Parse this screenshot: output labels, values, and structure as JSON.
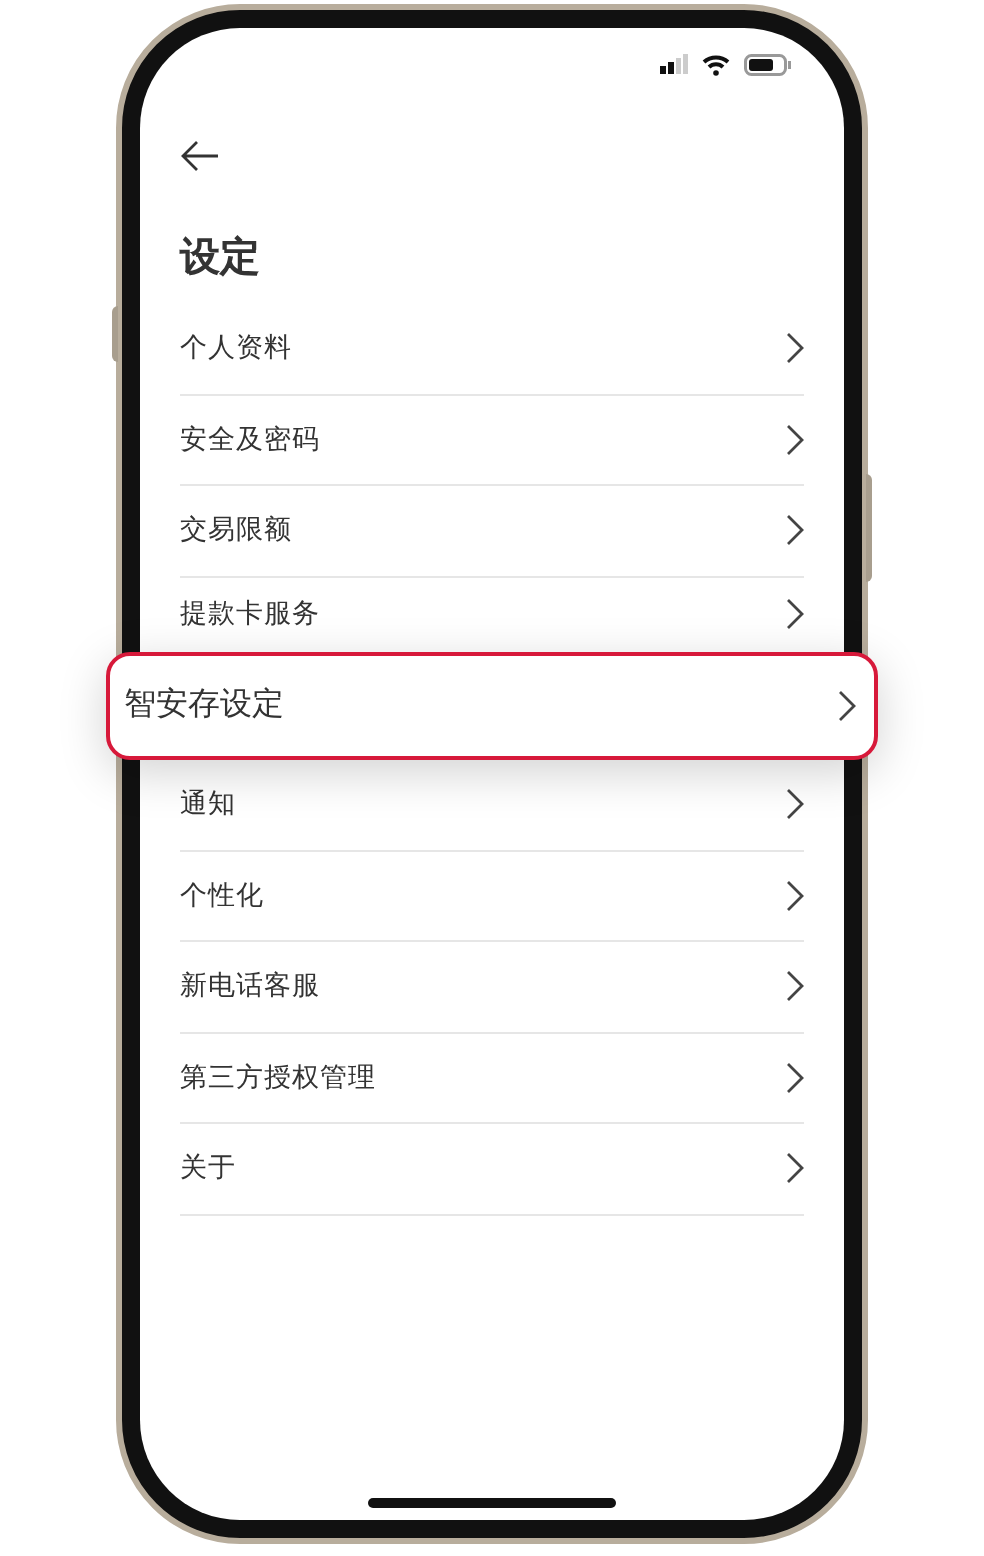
{
  "header": {
    "title": "设定"
  },
  "items": [
    {
      "label": "个人资料",
      "highlighted": false
    },
    {
      "label": "安全及密码",
      "highlighted": false
    },
    {
      "label": "交易限额",
      "highlighted": false
    },
    {
      "label": "提款卡服务",
      "highlighted": false
    },
    {
      "label": "智安存设定",
      "highlighted": true
    },
    {
      "label": "通知",
      "highlighted": false
    },
    {
      "label": "个性化",
      "highlighted": false
    },
    {
      "label": "新电话客服",
      "highlighted": false
    },
    {
      "label": "第三方授权管理",
      "highlighted": false
    },
    {
      "label": "关于",
      "highlighted": false
    }
  ]
}
